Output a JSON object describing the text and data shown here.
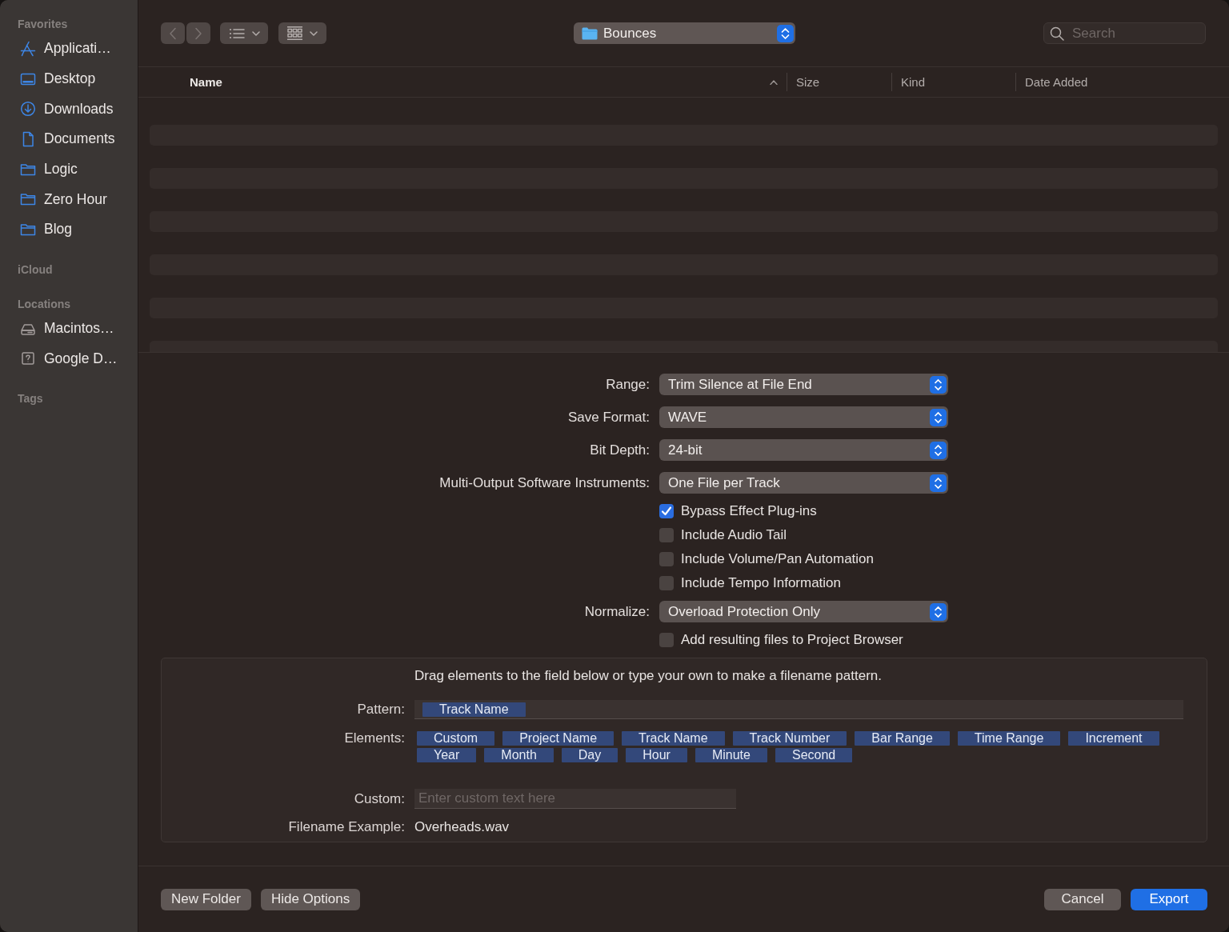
{
  "sidebar": {
    "sections": [
      {
        "heading": "Favorites",
        "items": [
          {
            "label": "Applicati…",
            "kind": "apps"
          },
          {
            "label": "Desktop",
            "kind": "desktop"
          },
          {
            "label": "Downloads",
            "kind": "downloads"
          },
          {
            "label": "Documents",
            "kind": "document"
          },
          {
            "label": "Logic",
            "kind": "folder"
          },
          {
            "label": "Zero Hour",
            "kind": "folder"
          },
          {
            "label": "Blog",
            "kind": "folder"
          }
        ]
      },
      {
        "heading": "iCloud"
      },
      {
        "heading": "Locations",
        "items": [
          {
            "label": "Macintos…",
            "kind": "drive"
          },
          {
            "label": "Google D…",
            "kind": "unknown"
          }
        ]
      },
      {
        "heading": "Tags"
      }
    ]
  },
  "toolbar": {
    "back": {
      "disabled": true
    },
    "forward": {
      "disabled": true
    },
    "location": "Bounces",
    "search": {
      "placeholder": "Search"
    }
  },
  "table": {
    "columns": [
      {
        "label": "Name",
        "sorted": true
      },
      {
        "label": "Size",
        "sorted": false
      },
      {
        "label": "Kind",
        "sorted": false
      },
      {
        "label": "Date Added",
        "sorted": false
      }
    ]
  },
  "options": {
    "rows": [
      {
        "kind": "popup",
        "label": "Range:",
        "value": "Trim Silence at File End"
      },
      {
        "kind": "popup",
        "label": "Save Format:",
        "value": "WAVE"
      },
      {
        "kind": "popup",
        "label": "Bit Depth:",
        "value": "24-bit"
      },
      {
        "kind": "popup",
        "label": "Multi-Output Software Instruments:",
        "value": "One File per Track"
      },
      {
        "kind": "checkbox",
        "label": "Bypass Effect Plug-ins",
        "checked": true
      },
      {
        "kind": "checkbox",
        "label": "Include Audio Tail",
        "checked": false
      },
      {
        "kind": "checkbox",
        "label": "Include Volume/Pan Automation",
        "checked": false
      },
      {
        "kind": "checkbox",
        "label": "Include Tempo Information",
        "checked": false
      },
      {
        "kind": "popup",
        "label": "Normalize:",
        "value": "Overload Protection Only"
      },
      {
        "kind": "checkbox",
        "label": "Add resulting files to Project Browser",
        "checked": false
      }
    ]
  },
  "filename_pattern": {
    "instructions": "Drag elements to the field below or type your own to make a filename pattern.",
    "pattern": {
      "label": "Pattern:",
      "tokens": [
        "Track Name"
      ]
    },
    "elements": {
      "label": "Elements:",
      "tokens": [
        "Custom",
        "Project Name",
        "Track Name",
        "Track Number",
        "Bar Range",
        "Time Range",
        "Increment",
        "Year",
        "Month",
        "Day",
        "Hour",
        "Minute",
        "Second"
      ]
    },
    "custom": {
      "label": "Custom:",
      "placeholder": "Enter custom text here"
    },
    "example": {
      "label": "Filename Example:",
      "value": "Overheads.wav"
    }
  },
  "footer": {
    "left_buttons": [
      {
        "label": "New Folder",
        "default": false
      },
      {
        "label": "Hide Options",
        "default": false
      }
    ],
    "right_buttons": [
      {
        "label": "Cancel",
        "default": false
      },
      {
        "label": "Export",
        "default": true
      }
    ]
  }
}
